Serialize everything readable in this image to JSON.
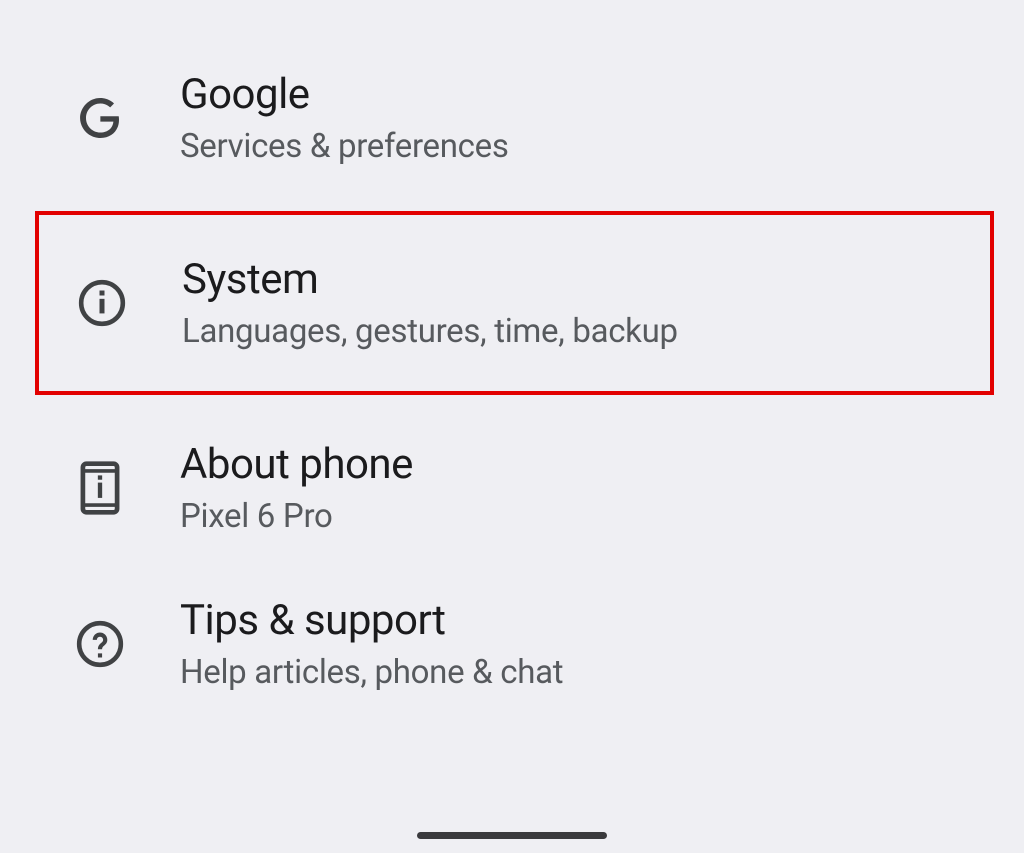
{
  "settings": {
    "items": [
      {
        "title": "Google",
        "subtitle": "Services & preferences"
      },
      {
        "title": "System",
        "subtitle": "Languages, gestures, time, backup"
      },
      {
        "title": "About phone",
        "subtitle": "Pixel 6 Pro"
      },
      {
        "title": "Tips & support",
        "subtitle": "Help articles, phone & chat"
      }
    ]
  }
}
